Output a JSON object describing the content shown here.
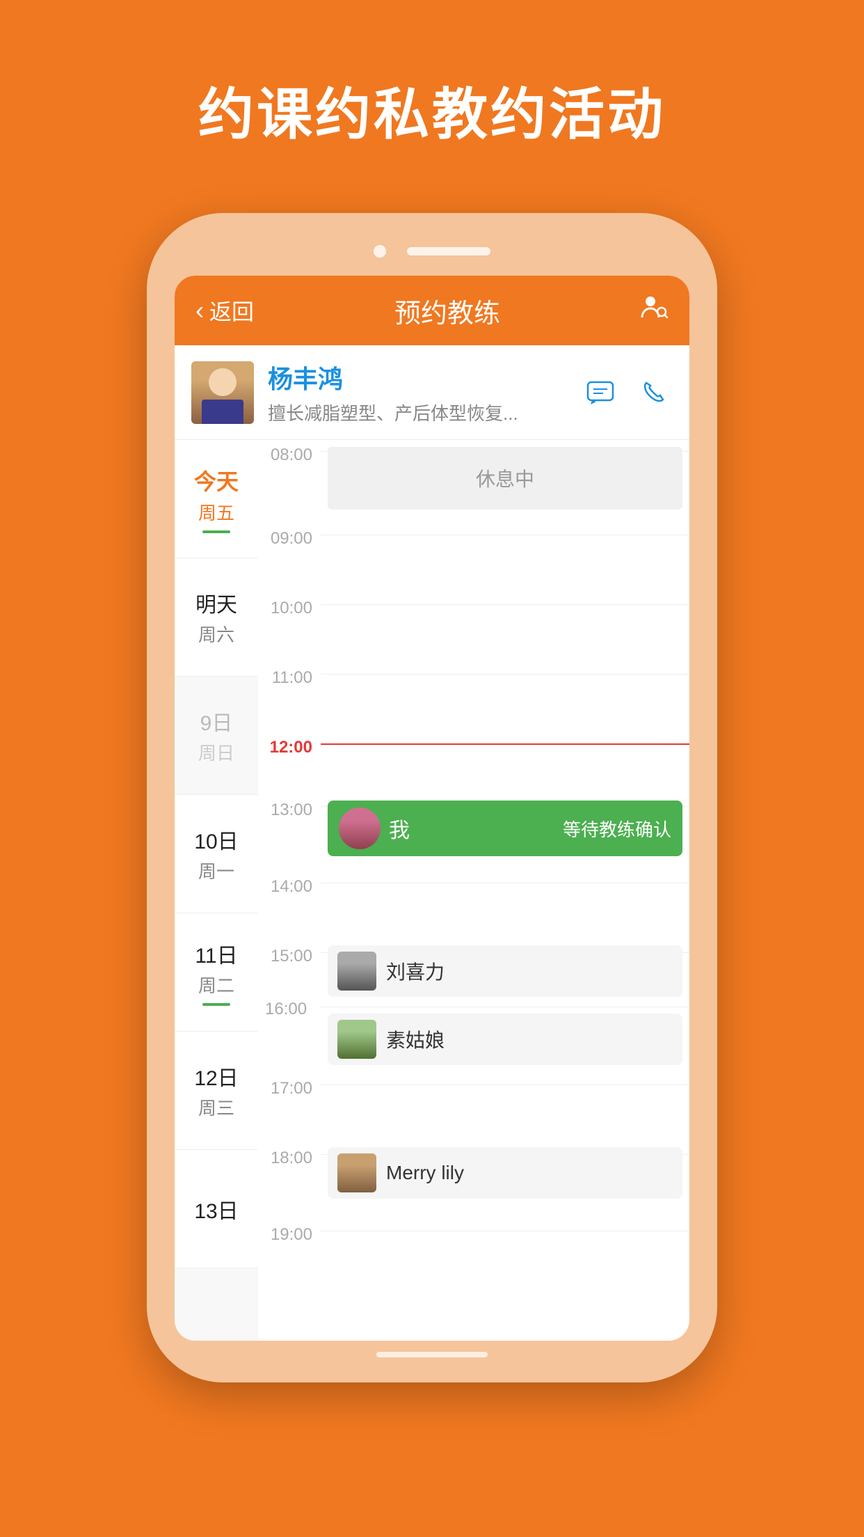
{
  "page": {
    "title": "约课约私教约活动",
    "background_color": "#F07820"
  },
  "header": {
    "back_label": "返回",
    "title": "预约教练",
    "icon": "👤"
  },
  "trainer": {
    "name": "杨丰鸿",
    "description": "擅长减脂塑型、产后体型恢复...",
    "message_icon": "💬",
    "phone_icon": "📞"
  },
  "dates": [
    {
      "label": "今天",
      "weekday": "周五",
      "type": "today",
      "underline": true
    },
    {
      "label": "明天",
      "weekday": "周六",
      "type": "normal"
    },
    {
      "label": "9日",
      "weekday": "周日",
      "type": "dimmed"
    },
    {
      "label": "10日",
      "weekday": "周一",
      "type": "normal"
    },
    {
      "label": "11日",
      "weekday": "周二",
      "type": "normal",
      "underline": true
    },
    {
      "label": "12日",
      "weekday": "周三",
      "type": "normal"
    },
    {
      "label": "13日",
      "weekday": "",
      "type": "normal"
    }
  ],
  "schedule": [
    {
      "time": "08:00",
      "type": "rest",
      "label": "休息中",
      "current": false
    },
    {
      "time": "09:00",
      "type": "empty",
      "current": false
    },
    {
      "time": "10:00",
      "type": "empty",
      "current": false
    },
    {
      "time": "11:00",
      "type": "empty",
      "current": false
    },
    {
      "time": "12:00",
      "type": "current-line",
      "current": true
    },
    {
      "time": "13:00",
      "type": "booking",
      "name": "我",
      "status": "等待教练确认",
      "avatar": "my"
    },
    {
      "time": "14:00",
      "type": "empty"
    },
    {
      "time": "15:00",
      "type": "users",
      "users": [
        {
          "name": "刘喜力",
          "avatar": "male1"
        },
        {
          "name": "素姑娘",
          "avatar": "female2"
        }
      ]
    },
    {
      "time": "17:00",
      "type": "empty"
    },
    {
      "time": "18:00",
      "type": "user-single",
      "name": "Merry lily",
      "avatar": "female3"
    },
    {
      "time": "19:00",
      "type": "empty"
    }
  ]
}
